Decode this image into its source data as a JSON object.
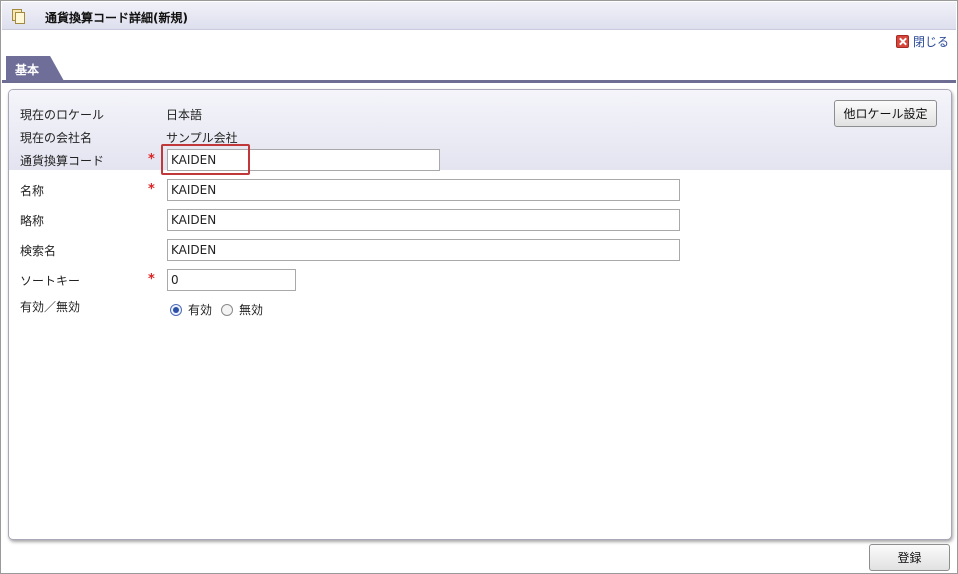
{
  "window": {
    "title": "通貨換算コード詳細(新規)",
    "close_label": "閉じる"
  },
  "tabs": [
    {
      "label": "基本",
      "active": true
    }
  ],
  "info": {
    "locale_label": "現在のロケール",
    "locale_value": "日本語",
    "company_label": "現在の会社名",
    "company_value": "サンプル会社",
    "other_locale_button": "他ロケール設定"
  },
  "form": {
    "required_mark": "*",
    "conversion_code": {
      "label": "通貨換算コード",
      "value": "KAIDEN",
      "required": true
    },
    "name": {
      "label": "名称",
      "value": "KAIDEN",
      "required": true
    },
    "short_name": {
      "label": "略称",
      "value": "KAIDEN",
      "required": false
    },
    "search_name": {
      "label": "検索名",
      "value": "KAIDEN",
      "required": false
    },
    "sort_key": {
      "label": "ソートキー",
      "value": "0",
      "required": true
    },
    "valid": {
      "label": "有効／無効",
      "options": [
        {
          "label": "有効",
          "checked": true
        },
        {
          "label": "無効",
          "checked": false
        }
      ]
    }
  },
  "footer": {
    "register_button": "登録"
  },
  "colors": {
    "tab_bg": "#6f6e98",
    "required": "#dd2222",
    "highlight": "#c0383a",
    "link": "#2b4a9a"
  },
  "icons": {
    "title": "document-icon",
    "close": "close-icon"
  }
}
